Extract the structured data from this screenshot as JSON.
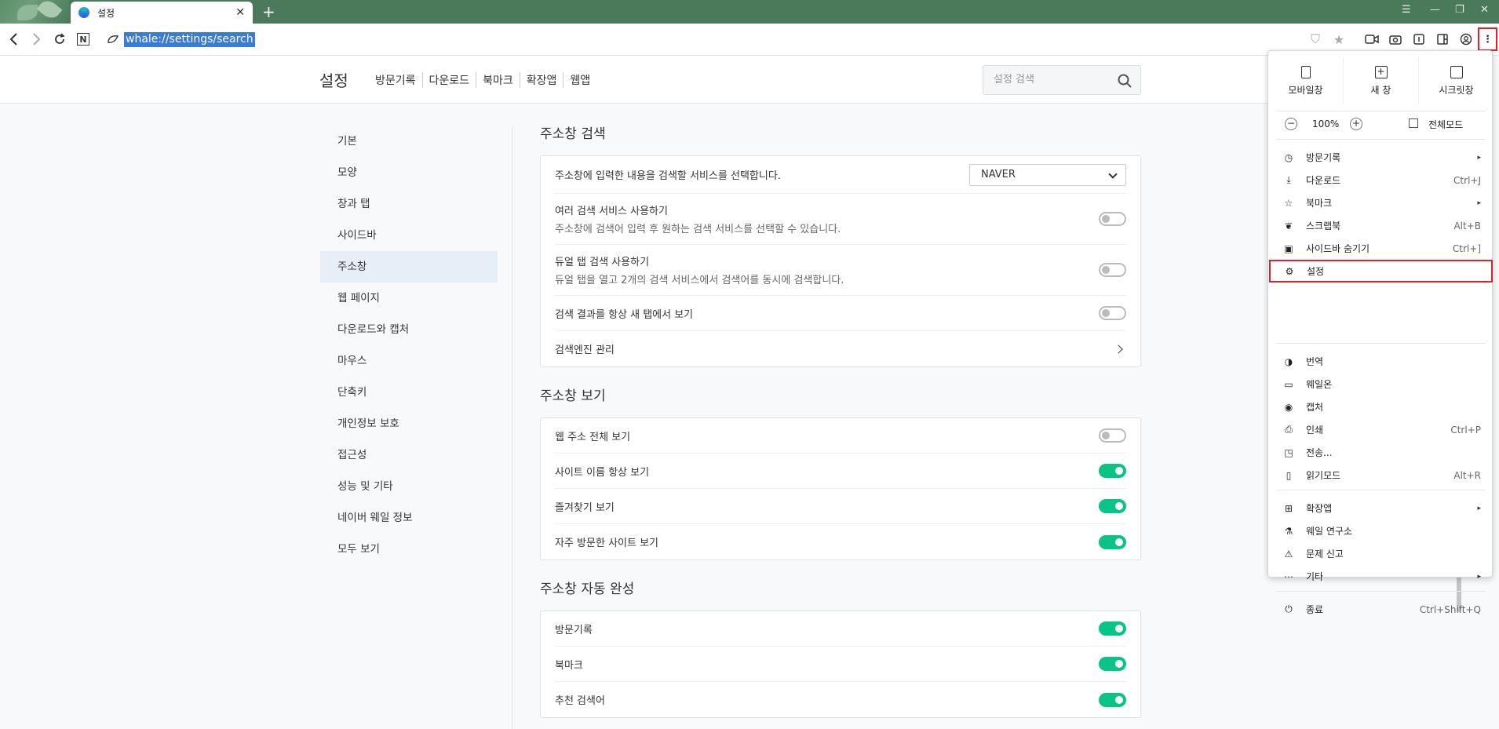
{
  "tab": {
    "title": "설정"
  },
  "address": {
    "url": "whale://settings/search"
  },
  "header": {
    "title": "설정",
    "links": [
      "방문기록",
      "다운로드",
      "북마크",
      "확장앱",
      "웹앱"
    ],
    "search_placeholder": "설정 검색"
  },
  "sidebar": {
    "items": [
      "기본",
      "모양",
      "창과 탭",
      "사이드바",
      "주소창",
      "웹 페이지",
      "다운로드와 캡처",
      "마우스",
      "단축키",
      "개인정보 보호",
      "접근성",
      "성능 및 기타",
      "네이버 웨일 정보",
      "모두 보기"
    ],
    "active_index": 4
  },
  "sections": [
    {
      "title": "주소창 검색",
      "rows": [
        {
          "label": "주소창에 입력한 내용을 검색할 서비스를 선택합니다.",
          "control": "select",
          "value": "NAVER"
        },
        {
          "label": "여러 검색 서비스 사용하기",
          "sub": "주소창에 검색어 입력 후 원하는 검색 서비스를 선택할 수 있습니다.",
          "control": "toggle",
          "on": false
        },
        {
          "label": "듀얼 탭 검색 사용하기",
          "sub": "듀얼 탭을 열고 2개의 검색 서비스에서 검색어를 동시에 검색합니다.",
          "control": "toggle",
          "on": false
        },
        {
          "label": "검색 결과를 항상 새 탭에서 보기",
          "control": "toggle",
          "on": false
        },
        {
          "label": "검색엔진 관리",
          "control": "arrow"
        }
      ]
    },
    {
      "title": "주소창 보기",
      "rows": [
        {
          "label": "웹 주소 전체 보기",
          "control": "toggle",
          "on": false
        },
        {
          "label": "사이트 이름 항상 보기",
          "control": "toggle",
          "on": true
        },
        {
          "label": "즐겨찾기 보기",
          "control": "toggle",
          "on": true
        },
        {
          "label": "자주 방문한 사이트 보기",
          "control": "toggle",
          "on": true
        }
      ]
    },
    {
      "title": "주소창 자동 완성",
      "rows": [
        {
          "label": "방문기록",
          "control": "toggle",
          "on": true
        },
        {
          "label": "북마크",
          "control": "toggle",
          "on": true
        },
        {
          "label": "추천 검색어",
          "control": "toggle",
          "on": true
        }
      ]
    }
  ],
  "menu": {
    "top": [
      "모바일창",
      "새 창",
      "시크릿창"
    ],
    "zoom": {
      "minus": "−",
      "value": "100%",
      "plus": "+",
      "fullscreen": "전체모드"
    },
    "groups": [
      [
        {
          "label": "방문기록",
          "shortcut": "",
          "arrow": true,
          "icon": "history-icon"
        },
        {
          "label": "다운로드",
          "shortcut": "Ctrl+J",
          "arrow": false,
          "icon": "download-icon"
        },
        {
          "label": "북마크",
          "shortcut": "",
          "arrow": true,
          "icon": "star-icon"
        },
        {
          "label": "스크랩북",
          "shortcut": "Alt+B",
          "arrow": false,
          "icon": "scrapbook-icon"
        },
        {
          "label": "사이드바 숨기기",
          "shortcut": "Ctrl+]",
          "arrow": false,
          "icon": "sidebar-icon"
        },
        {
          "label": "설정",
          "shortcut": "",
          "arrow": false,
          "icon": "gear-icon",
          "highlight": true
        }
      ],
      [
        {
          "label": "번역",
          "shortcut": "",
          "arrow": false,
          "icon": "translate-icon"
        },
        {
          "label": "웨일온",
          "shortcut": "",
          "arrow": false,
          "icon": "video-icon"
        },
        {
          "label": "캡처",
          "shortcut": "",
          "arrow": false,
          "icon": "camera-icon"
        },
        {
          "label": "인쇄",
          "shortcut": "Ctrl+P",
          "arrow": false,
          "icon": "print-icon"
        },
        {
          "label": "전송...",
          "shortcut": "",
          "arrow": false,
          "icon": "cast-icon"
        },
        {
          "label": "읽기모드",
          "shortcut": "Alt+R",
          "arrow": false,
          "icon": "book-icon"
        }
      ],
      [
        {
          "label": "확장앱",
          "shortcut": "",
          "arrow": true,
          "icon": "extensions-icon"
        },
        {
          "label": "웨일 연구소",
          "shortcut": "",
          "arrow": false,
          "icon": "flask-icon"
        },
        {
          "label": "문제 신고",
          "shortcut": "",
          "arrow": false,
          "icon": "report-icon"
        },
        {
          "label": "기타",
          "shortcut": "",
          "arrow": true,
          "icon": "more-icon"
        }
      ],
      [
        {
          "label": "종료",
          "shortcut": "Ctrl+Shift+Q",
          "arrow": false,
          "icon": "power-icon"
        }
      ]
    ]
  }
}
